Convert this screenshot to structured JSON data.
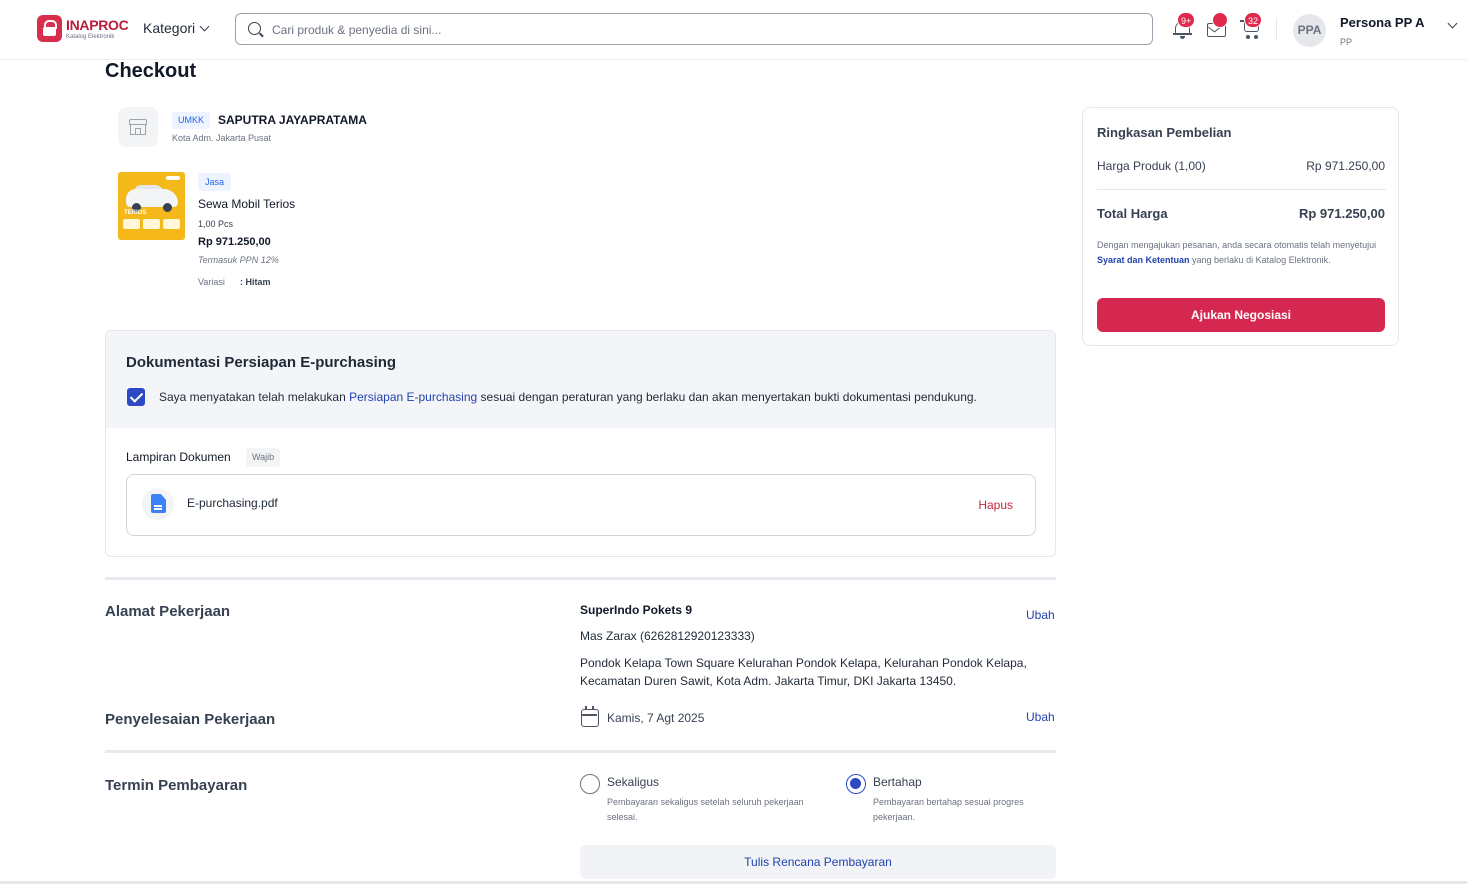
{
  "header": {
    "logo_main": "INAPROC",
    "logo_sub": "Katalog Elektronik",
    "kategori_label": "Kategori",
    "search_placeholder": "Cari produk & penyedia di sini...",
    "notif_badge": "9+",
    "cart_badge": "32",
    "avatar_initials": "PPA",
    "user_name": "Persona PP A",
    "user_role": "PP",
    "icons": [
      "search-icon",
      "bell-icon",
      "mail-icon",
      "cart-icon",
      "chevron-down-icon"
    ]
  },
  "page": {
    "title": "Checkout"
  },
  "store": {
    "badge": "UMKK",
    "name": "SAPUTRA JAYAPRATAMA",
    "location": "Kota Adm. Jakarta Pusat"
  },
  "product": {
    "type_badge": "Jasa",
    "name": "Sewa Mobil Terios",
    "qty": "1,00 Pcs",
    "price": "Rp 971.250,00",
    "tax_note": "Termasuk PPN 12%",
    "variant_label": "Variasi",
    "variant_value": ": Hitam",
    "image_tag": "TERIOS"
  },
  "documentation": {
    "title": "Dokumentasi Persiapan E-purchasing",
    "checked": true,
    "statement_pre": "Saya menyatakan telah melakukan ",
    "statement_link": "Persiapan E-purchasing",
    "statement_post": " sesuai dengan peraturan yang berlaku dan akan menyertakan bukti dokumentasi pendukung.",
    "attachment_label": "Lampiran Dokumen",
    "required_badge": "Wajib",
    "file_name": "E-purchasing.pdf",
    "delete_label": "Hapus"
  },
  "address": {
    "section_title": "Alamat Pekerjaan",
    "name": "SuperIndo Pokets 9",
    "contact": "Mas Zarax (6262812920123333)",
    "line": "Pondok Kelapa Town Square Kelurahan Pondok Kelapa, Kelurahan Pondok Kelapa, Kecamatan Duren Sawit, Kota Adm. Jakarta Timur, DKI Jakarta 13450.",
    "edit_label": "Ubah"
  },
  "completion": {
    "section_title": "Penyelesaian Pekerjaan",
    "date": "Kamis, 7 Agt 2025",
    "edit_label": "Ubah"
  },
  "payment": {
    "section_title": "Termin Pembayaran",
    "options": [
      {
        "label": "Sekaligus",
        "desc": "Pembayaran sekaligus setelah seluruh pekerjaan selesai.",
        "selected": false
      },
      {
        "label": "Bertahap",
        "desc": "Pembayaran bertahap sesuai progres pekerjaan.",
        "selected": true
      }
    ],
    "plan_button": "Tulis Rencana Pembayaran"
  },
  "summary": {
    "title": "Ringkasan Pembelian",
    "product_label": "Harga Produk (1,00)",
    "product_value": "Rp 971.250,00",
    "total_label": "Total Harga",
    "total_value": "Rp 971.250,00",
    "note_pre": "Dengan mengajukan pesanan, anda secara otomatis telah menyetujui ",
    "note_link": "Syarat dan Ketentuan",
    "note_post": " yang berlaku di Katalog Elektronik.",
    "submit_label": "Ajukan Negosiasi"
  },
  "colors": {
    "brand_red": "#d52850",
    "link_blue": "#2142b0",
    "check_blue": "#2d49c4",
    "badge_red": "#e0294d"
  }
}
